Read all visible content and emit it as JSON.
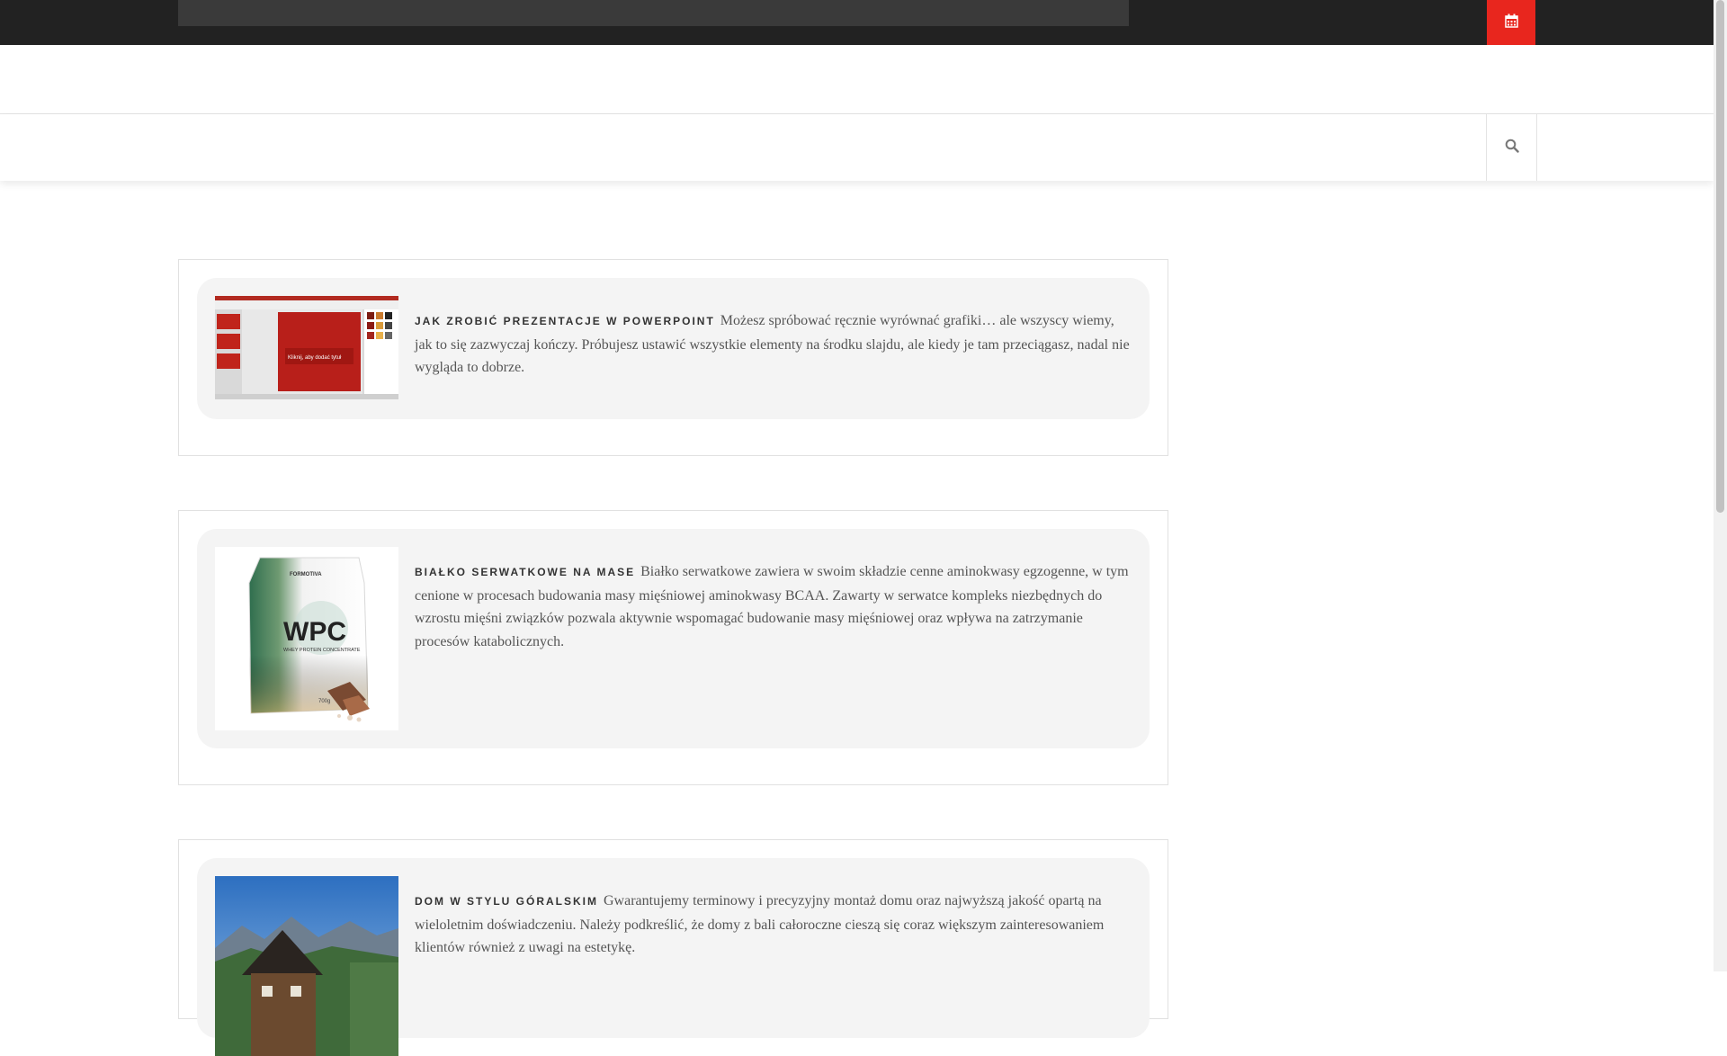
{
  "header": {
    "calendar_icon": "calendar-icon",
    "search_icon": "search-icon",
    "accent_color": "#e8261e"
  },
  "posts": [
    {
      "title": "JAK ZROBIĆ PREZENTACJE W POWERPOINT",
      "excerpt": "Możesz spróbować ręcznie wyrównać grafiki… ale wszyscy wiemy, jak to się zazwyczaj kończy. Próbujesz ustawić wszystkie elementy na środku slajdu, ale kiedy je tam przeciągasz, nadal nie wygląda to dobrze.",
      "image_text": "Kliknij, aby dodać tytuł"
    },
    {
      "title": "BIAŁKO SERWATKOWE NA MASE",
      "excerpt": "Białko serwatkowe zawiera w swoim składzie cenne aminokwasy egzogenne, w tym cenione w procesach budowania masy mięśniowej aminokwasy BCAA. Zawarty w serwatce kompleks niezbędnych do wzrostu mięśni związków pozwala aktywnie wspomagać budowanie masy mięśniowej oraz wpływa na zatrzymanie procesów katabolicznych.",
      "image_brand": "FORMOTIVA",
      "image_label": "WPC",
      "image_sublabel": "WHEY PROTEIN CONCENTRATE",
      "image_weight": "700g"
    },
    {
      "title": "DOM W STYLU GÓRALSKIM",
      "excerpt": "Gwarantujemy terminowy i precyzyjny montaż domu oraz najwyższą jakość opartą na wieloletnim doświadczeniu. Należy podkreślić, że domy z bali całoroczne cieszą się coraz większym zainteresowaniem klientów również z uwagi na estetykę."
    }
  ]
}
